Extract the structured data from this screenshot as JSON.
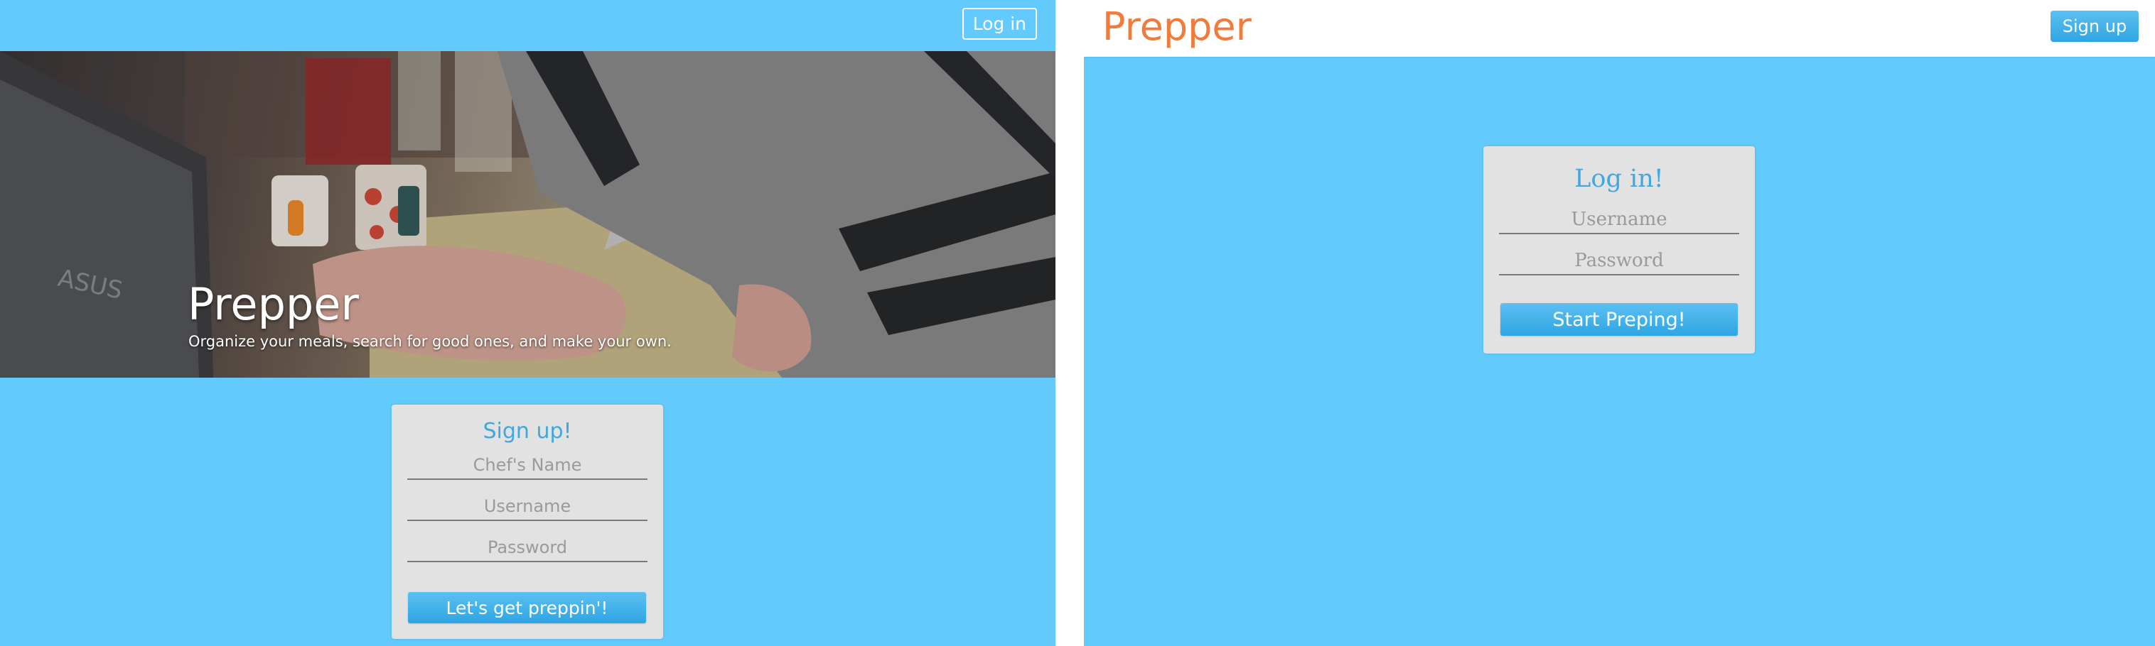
{
  "left_screen": {
    "header": {
      "login_button": "Log in"
    },
    "hero": {
      "title": "Prepper",
      "subtitle": "Organize your meals, search for good ones, and make your own."
    },
    "signup_form": {
      "title": "Sign up!",
      "chef_name_placeholder": "Chef's Name",
      "username_placeholder": "Username",
      "password_placeholder": "Password",
      "submit_label": "Let's get preppin'!"
    }
  },
  "right_screen": {
    "navbar": {
      "brand": "Prepper",
      "signup_button": "Sign up"
    },
    "login_form": {
      "title": "Log in!",
      "username_placeholder": "Username",
      "password_placeholder": "Password",
      "submit_label": "Start Preping!"
    }
  },
  "colors": {
    "background": "#63cafd",
    "card": "#e2e2e2",
    "accent_blue": "#3fa8dd",
    "button_blue": "#2ea5e3",
    "brand_orange": "#f07c3b"
  }
}
